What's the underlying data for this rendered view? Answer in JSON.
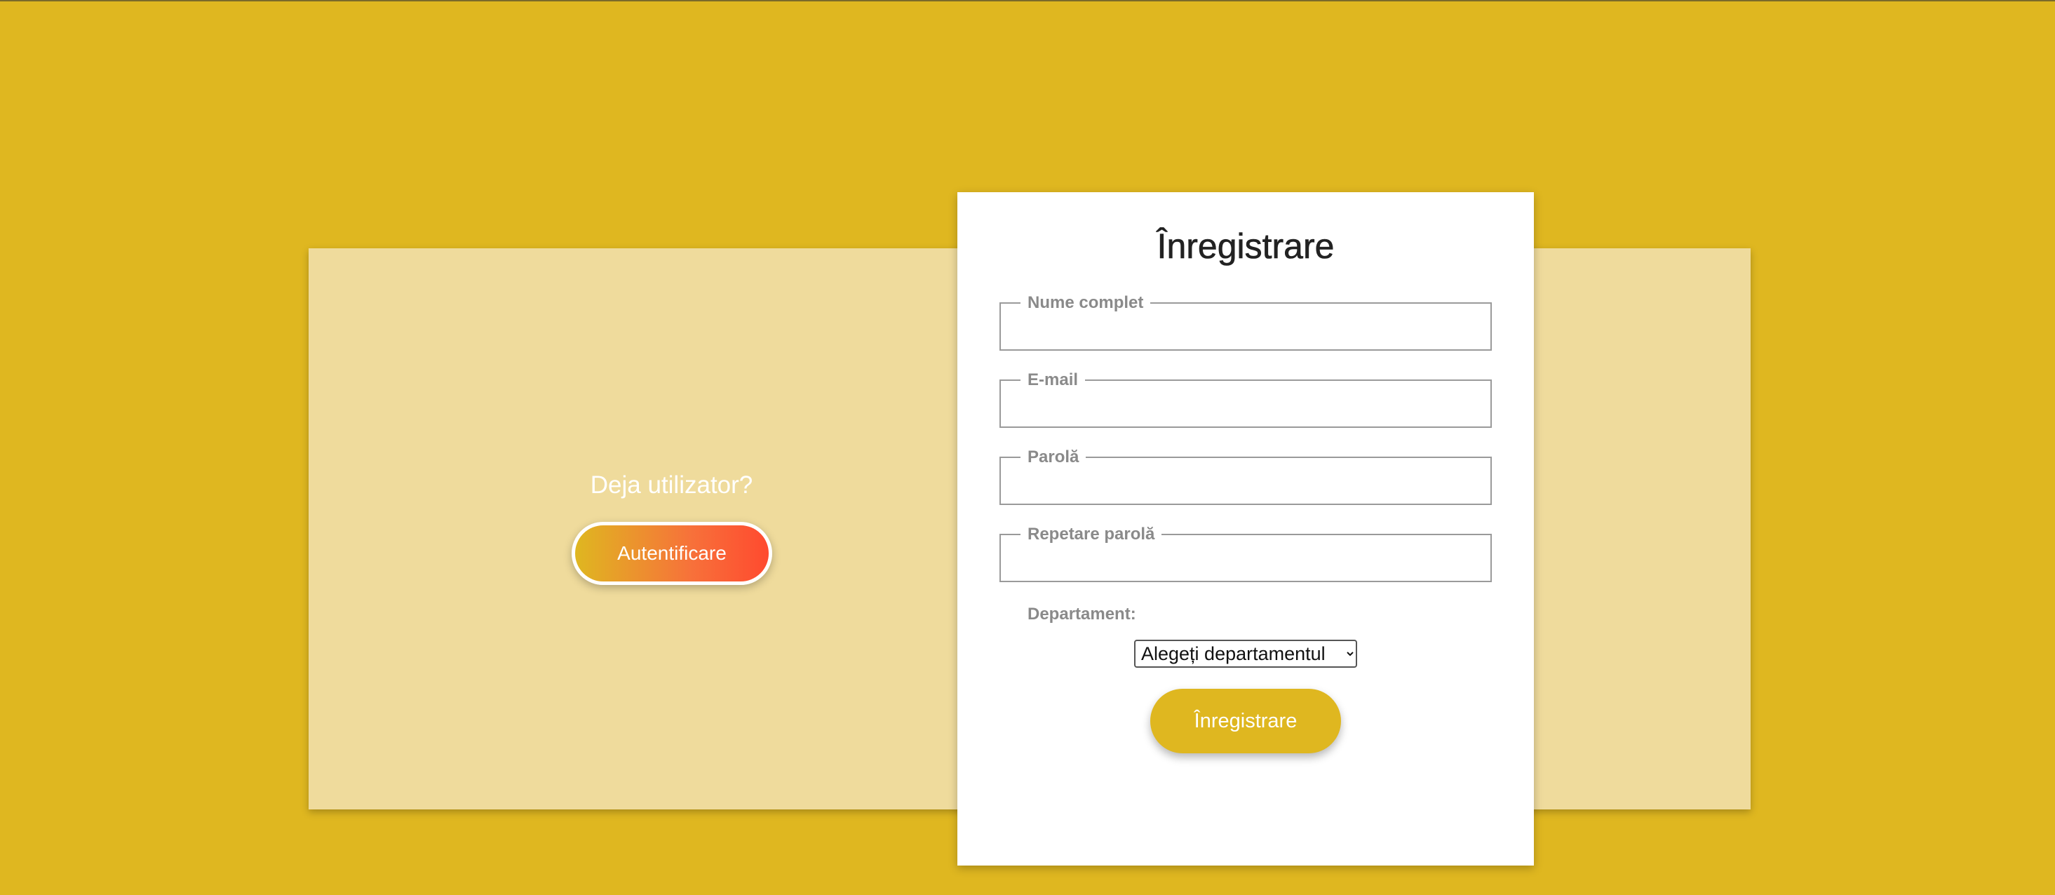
{
  "colors": {
    "background": "#DFB720",
    "panel": "#EFDB9C",
    "card": "#FFFFFF",
    "accent_gradient_start": "#DFB720",
    "accent_gradient_end": "#FF4A2F",
    "label_gray": "#8A8A8A"
  },
  "login_side": {
    "prompt": "Deja utilizator?",
    "button_label": "Autentificare"
  },
  "register_form": {
    "title": "Înregistrare",
    "fields": {
      "full_name": {
        "label": "Nume complet",
        "value": ""
      },
      "email": {
        "label": "E-mail",
        "value": ""
      },
      "password": {
        "label": "Parolă",
        "value": ""
      },
      "repeat_password": {
        "label": "Repetare parolă",
        "value": ""
      }
    },
    "department": {
      "label": "Departament:",
      "selected": "Alegeți departamentul"
    },
    "submit_label": "Înregistrare"
  }
}
